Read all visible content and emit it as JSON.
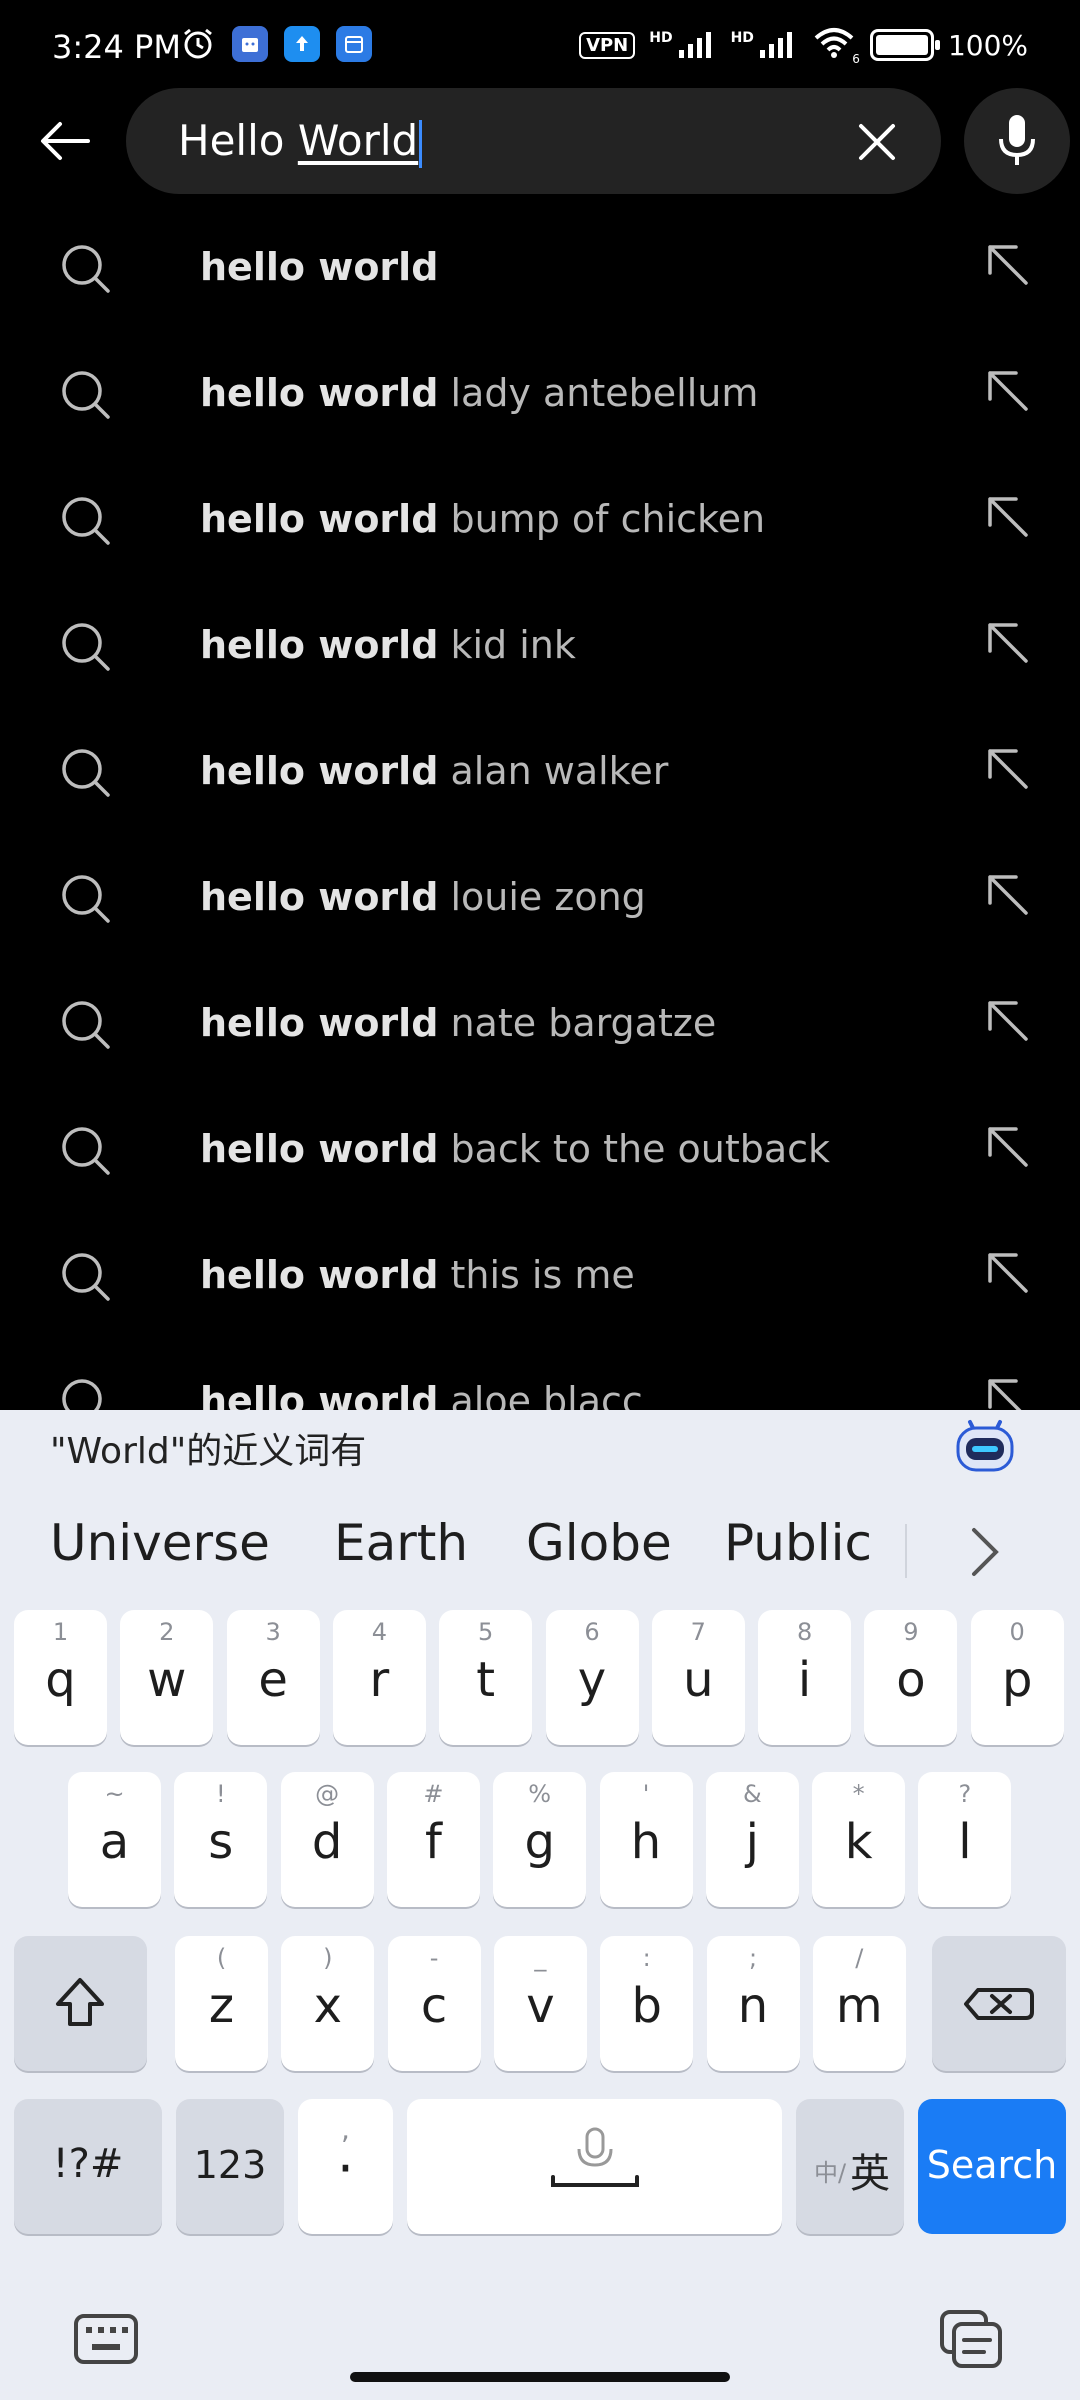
{
  "status_bar": {
    "time": "3:24 PM",
    "vpn": "VPN",
    "net1": "HD",
    "net2": "HD",
    "wifi_label": "6",
    "battery_pct": "100%"
  },
  "search": {
    "query_part1": "Hello ",
    "query_part2": "World"
  },
  "suggestions": [
    {
      "bold": "hello world",
      "rest": ""
    },
    {
      "bold": "hello world",
      "rest": " lady antebellum"
    },
    {
      "bold": "hello world",
      "rest": " bump of chicken"
    },
    {
      "bold": "hello world",
      "rest": " kid ink"
    },
    {
      "bold": "hello world",
      "rest": " alan walker"
    },
    {
      "bold": "hello world",
      "rest": " louie zong"
    },
    {
      "bold": "hello world",
      "rest": " nate bargatze"
    },
    {
      "bold": "hello world",
      "rest": " back to the outback"
    },
    {
      "bold": "hello world",
      "rest": " this is me"
    },
    {
      "bold": "hello world",
      "rest": " aloe blacc"
    }
  ],
  "keyboard": {
    "synonym_header": "\"World\"的近义词有",
    "candidates": [
      "Universe",
      "Earth",
      "Globe",
      "Public"
    ],
    "row1": [
      {
        "main": "q",
        "sub": "1"
      },
      {
        "main": "w",
        "sub": "2"
      },
      {
        "main": "e",
        "sub": "3"
      },
      {
        "main": "r",
        "sub": "4"
      },
      {
        "main": "t",
        "sub": "5"
      },
      {
        "main": "y",
        "sub": "6"
      },
      {
        "main": "u",
        "sub": "7"
      },
      {
        "main": "i",
        "sub": "8"
      },
      {
        "main": "o",
        "sub": "9"
      },
      {
        "main": "p",
        "sub": "0"
      }
    ],
    "row2": [
      {
        "main": "a",
        "sub": "~"
      },
      {
        "main": "s",
        "sub": "!"
      },
      {
        "main": "d",
        "sub": "@"
      },
      {
        "main": "f",
        "sub": "#"
      },
      {
        "main": "g",
        "sub": "%"
      },
      {
        "main": "h",
        "sub": "'"
      },
      {
        "main": "j",
        "sub": "&"
      },
      {
        "main": "k",
        "sub": "*"
      },
      {
        "main": "l",
        "sub": "?"
      }
    ],
    "row3": [
      {
        "main": "z",
        "sub": "("
      },
      {
        "main": "x",
        "sub": ")"
      },
      {
        "main": "c",
        "sub": "-"
      },
      {
        "main": "v",
        "sub": "_"
      },
      {
        "main": "b",
        "sub": ":"
      },
      {
        "main": "n",
        "sub": ";"
      },
      {
        "main": "m",
        "sub": "/"
      }
    ],
    "symbols_label": "!?#",
    "numbers_label": "123",
    "punct_main": "·",
    "punct_sub": ",",
    "lang_small": "中/",
    "lang_big": "英",
    "search_label": "Search"
  },
  "colors": {
    "accent": "#1a7cf5",
    "keyboard_bg": "#eaedf4"
  }
}
